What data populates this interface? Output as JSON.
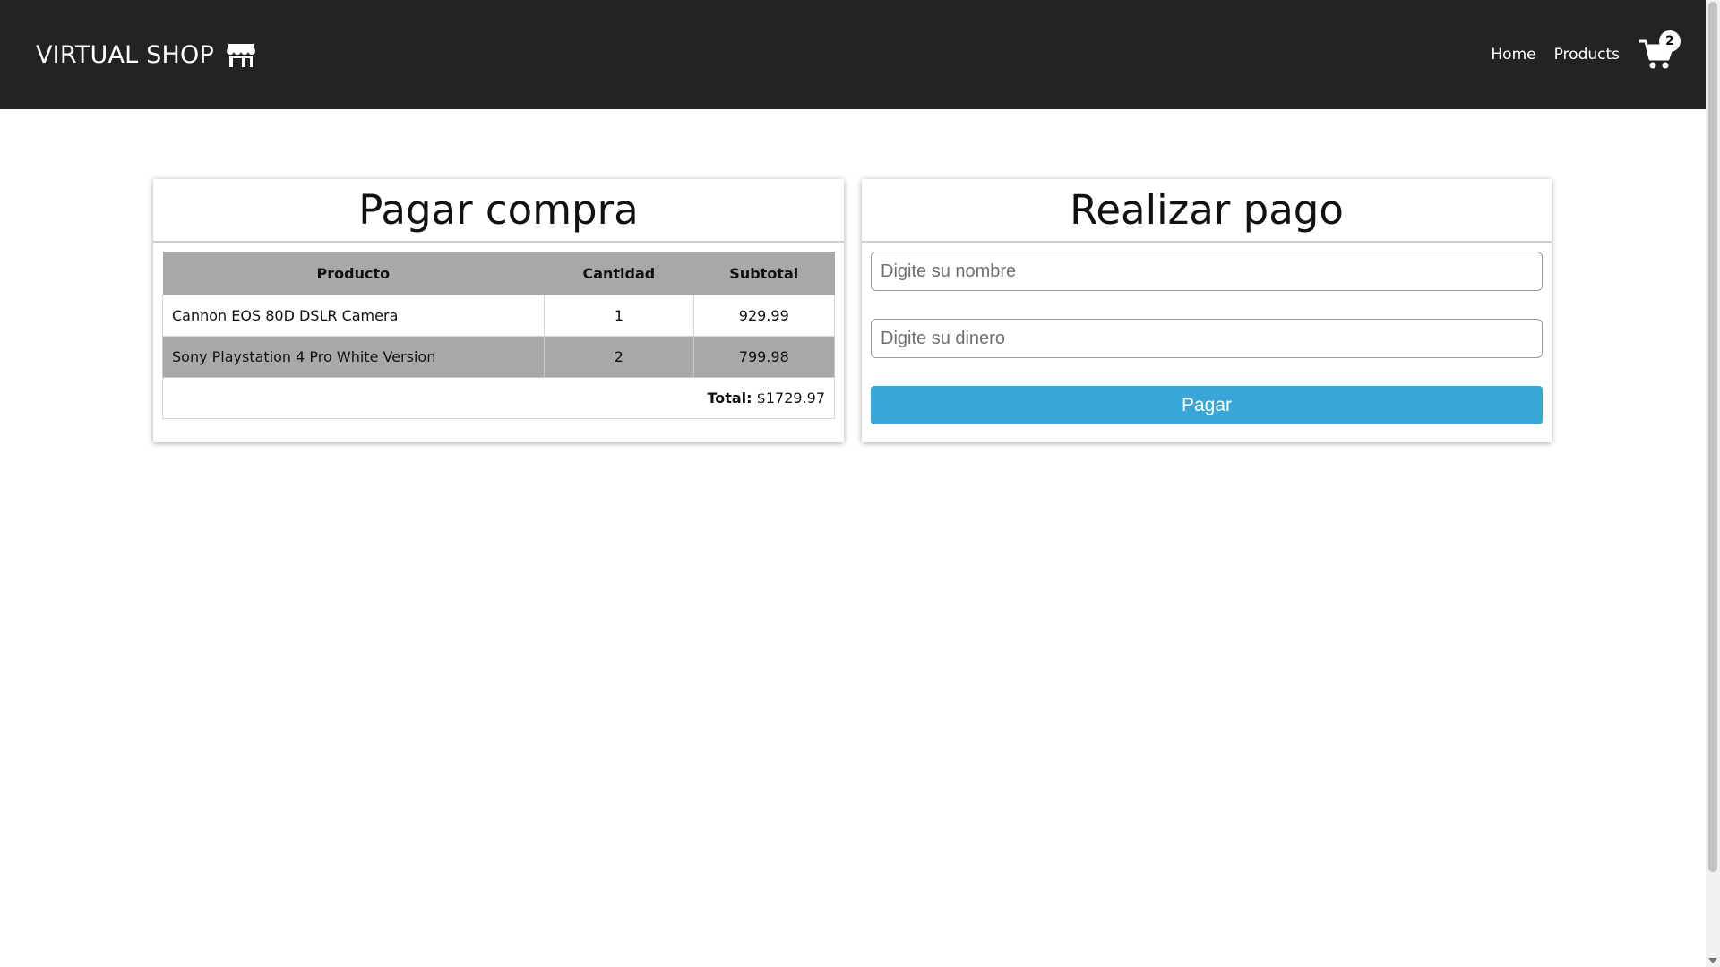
{
  "header": {
    "brand": "VIRTUAL SHOP",
    "brand_icon": "store-icon",
    "nav": [
      "Home",
      "Products"
    ],
    "cart_icon": "shopping-cart-icon",
    "cart_count": "2"
  },
  "checkout": {
    "title": "Pagar compra",
    "columns": [
      "Producto",
      "Cantidad",
      "Subtotal"
    ],
    "rows": [
      {
        "product": "Cannon EOS 80D DSLR Camera",
        "qty": "1",
        "subtotal": "929.99"
      },
      {
        "product": "Sony Playstation 4 Pro White Version",
        "qty": "2",
        "subtotal": "799.98"
      }
    ],
    "total_label": "Total:",
    "total_value": "$1729.97"
  },
  "payment": {
    "title": "Realizar pago",
    "name_placeholder": "Digite su nombre",
    "money_placeholder": "Digite su dinero",
    "pay_label": "Pagar"
  },
  "colors": {
    "navbar": "#232323",
    "table_header": "#a8a8a8",
    "button": "#38a6d6"
  }
}
